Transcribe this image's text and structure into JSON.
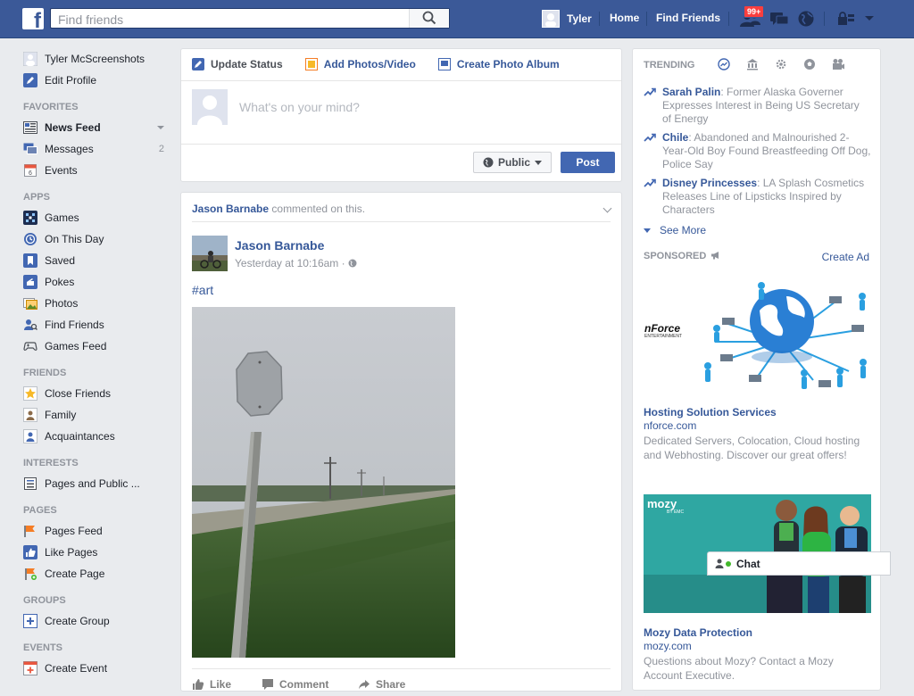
{
  "topbar": {
    "logo_letter": "f",
    "search_placeholder": "Find friends",
    "user_name": "Tyler",
    "home": "Home",
    "find_friends": "Find Friends",
    "friend_requests_badge": "99+"
  },
  "left": {
    "profile_name": "Tyler McScreenshots",
    "edit_profile": "Edit Profile",
    "favorites_head": "FAVORITES",
    "news_feed": "News Feed",
    "messages": "Messages",
    "messages_count": "2",
    "events": "Events",
    "apps_head": "APPS",
    "games": "Games",
    "on_this_day": "On This Day",
    "saved": "Saved",
    "pokes": "Pokes",
    "photos": "Photos",
    "find_friends": "Find Friends",
    "games_feed": "Games Feed",
    "friends_head": "FRIENDS",
    "close_friends": "Close Friends",
    "family": "Family",
    "acquaintances": "Acquaintances",
    "interests_head": "INTERESTS",
    "pages_public": "Pages and Public ...",
    "pages_head": "PAGES",
    "pages_feed": "Pages Feed",
    "like_pages": "Like Pages",
    "create_page": "Create Page",
    "groups_head": "GROUPS",
    "create_group": "Create Group",
    "events_head": "EVENTS",
    "create_event": "Create Event"
  },
  "composer": {
    "tab_status": "Update Status",
    "tab_photos": "Add Photos/Video",
    "tab_album": "Create Photo Album",
    "placeholder": "What's on your mind?",
    "privacy": "Public",
    "post": "Post"
  },
  "story": {
    "actor": "Jason Barnabe",
    "action": "commented on this.",
    "author": "Jason Barnabe",
    "time": "Yesterday at 10:16am",
    "dot": "·",
    "text": "#art",
    "like": "Like",
    "comment": "Comment",
    "share": "Share"
  },
  "right": {
    "trending_head": "TRENDING",
    "trends": [
      {
        "name": "Sarah Palin",
        "text": ": Former Alaska Governer Expresses Interest in Being US Secretary of Energy"
      },
      {
        "name": "Chile",
        "text": ": Abandoned and Malnourished 2-Year-Old Boy Found Breastfeeding Off Dog, Police Say"
      },
      {
        "name": "Disney Princesses",
        "text": ": LA Splash Cosmetics Releases Line of Lipsticks Inspired by Characters"
      }
    ],
    "see_more": "See More",
    "sponsored": "SPONSORED",
    "create_ad": "Create Ad",
    "ad1": {
      "logo_text": "nForce",
      "logo_sub": "ENTERTAINMENT",
      "title": "Hosting Solution Services",
      "url": "nforce.com",
      "desc": "Dedicated Servers, Colocation, Cloud hosting and Webhosting. Discover our great offers!"
    },
    "ad2": {
      "logo_text": "mozy",
      "logo_sub": "BY EMC",
      "title": "Mozy Data Protection",
      "url": "mozy.com",
      "desc": "Questions about Mozy? Contact a Mozy Account Executive."
    }
  },
  "chat": {
    "label": "Chat"
  },
  "colors": {
    "brand": "#3b5998",
    "link": "#365899",
    "badge": "#fa3e3e",
    "online": "#42b72a"
  }
}
